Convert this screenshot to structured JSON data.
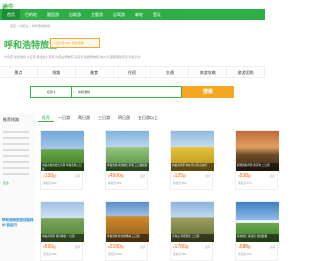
{
  "site": {
    "logo": "途牛",
    "brand_color": "#3ab54a"
  },
  "nav": [
    {
      "label": "首页"
    },
    {
      "label": "目的地"
    },
    {
      "label": "跟团游"
    },
    {
      "label": "自助游"
    },
    {
      "label": "主题游"
    },
    {
      "label": "自驾游"
    },
    {
      "label": "邮轮"
    },
    {
      "label": "签证"
    }
  ],
  "breadcrumb": "首页 > 内蒙古 > 呼和浩特旅游",
  "header": {
    "title": "呼和浩特旅游",
    "subtitle": "大草原 呼和浩特 大召寺 希拉穆仁草原 内蒙古博物馆 五塔寺 昭君博物院 响沙湾 辉腾锡勒草原 呼伦贝尔",
    "app_badge": "下载途牛APP 领优惠券"
  },
  "tabs": [
    {
      "label": "景点"
    },
    {
      "label": "线路"
    },
    {
      "label": "美食"
    },
    {
      "label": "住宿"
    },
    {
      "label": "交通"
    },
    {
      "label": "旅游攻略"
    },
    {
      "label": "旅游团购"
    }
  ],
  "search": {
    "city": "北京",
    "value": "呼和浩特",
    "button": "搜索"
  },
  "sidebar": {
    "title": "推荐线路",
    "link": "更多",
    "promo": "呼和浩特旅游线路特价/自由行"
  },
  "filters": [
    {
      "label": "推荐",
      "active": true
    },
    {
      "label": "一日游"
    },
    {
      "label": "两日游"
    },
    {
      "label": "三日游"
    },
    {
      "label": "四日游"
    },
    {
      "label": "五日游以上"
    }
  ],
  "cards": [
    {
      "caption": "内蒙古希拉穆仁草原 呼和浩特二日游",
      "price": "138",
      "reviews": "点评",
      "meta": "满意度 96%",
      "tone": "sky-grass"
    },
    {
      "caption": "呼和浩特-希拉穆仁草原 三日跟团游",
      "price": "4500",
      "reviews": "点评",
      "meta": "满意度 98%",
      "tone": "yurts"
    },
    {
      "caption": "内蒙古草原 响沙湾沙漠 自由行",
      "price": "125",
      "reviews": "点评",
      "meta": "满意度 95%",
      "tone": "flowers"
    },
    {
      "caption": "辉腾锡勒草原 黄花沟 二日游",
      "price": "538",
      "reviews": "点评",
      "meta": "满意度 97%",
      "tone": "sunset"
    },
    {
      "caption": "内蒙古草原 骑马体验 一日游",
      "price": "590",
      "reviews": "点评",
      "meta": "满意度 96%",
      "tone": "horses"
    },
    {
      "caption": "呼和浩特 秋色胡杨林 三日游",
      "price": "2180",
      "reviews": "点评",
      "meta": "满意度 94%",
      "tone": "autumn"
    },
    {
      "caption": "大青山 草原风光 二日游",
      "price": "1780",
      "reviews": "点评",
      "meta": "满意度 95%",
      "tone": "hills"
    },
    {
      "caption": "希拉穆仁 蒙古包 住宿套餐",
      "price": "586",
      "reviews": "点评",
      "meta": "满意度 97%",
      "tone": "blue-sky"
    }
  ],
  "watermark": "途牛"
}
